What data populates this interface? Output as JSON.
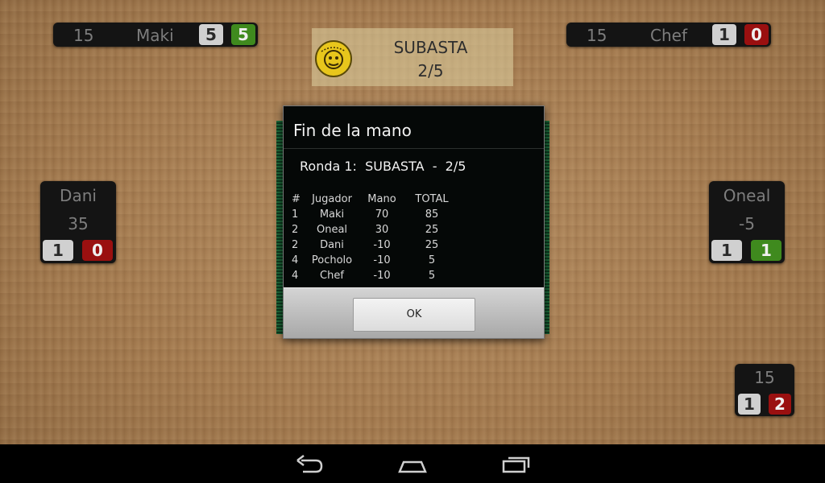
{
  "top_left_player": {
    "points": "15",
    "name": "Maki",
    "badge_a": "5",
    "badge_b": "5"
  },
  "top_right_player": {
    "points": "15",
    "name": "Chef",
    "badge_a": "1",
    "badge_b": "0"
  },
  "left_player": {
    "name": "Dani",
    "score": "35",
    "badge_a": "1",
    "badge_b": "0"
  },
  "right_player": {
    "name": "Oneal",
    "score": "-5",
    "badge_a": "1",
    "badge_b": "1"
  },
  "bottom_right_player": {
    "score": "15",
    "badge_a": "1",
    "badge_b": "2"
  },
  "round_panel": {
    "mode": "SUBASTA",
    "round": "2/5"
  },
  "dialog": {
    "title": "Fin de la mano",
    "subtitle": "Ronda 1:  SUBASTA  -  2/5",
    "headers": [
      "#",
      "Jugador",
      "Mano",
      "TOTAL"
    ],
    "rows": [
      [
        "1",
        "Maki",
        "70",
        "85"
      ],
      [
        "2",
        "Oneal",
        "30",
        "25"
      ],
      [
        "2",
        "Dani",
        "-10",
        "25"
      ],
      [
        "4",
        "Pocholo",
        "-10",
        "5"
      ],
      [
        "4",
        "Chef",
        "-10",
        "5"
      ]
    ],
    "ok_label": "OK"
  },
  "colors": {
    "badge_gray": "#d0d0d0",
    "badge_green": "#3f8a1e",
    "badge_red": "#9a1010",
    "panel_dark": "#141414"
  },
  "navbar": {
    "icons": [
      "back-icon",
      "home-icon",
      "recent-apps-icon"
    ]
  }
}
